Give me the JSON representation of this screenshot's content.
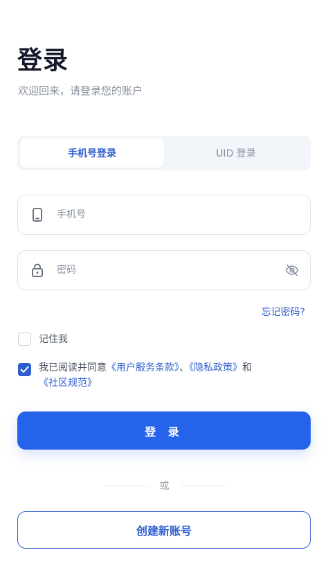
{
  "header": {
    "title": "登录",
    "subtitle": "欢迎回来，请登录您的账户"
  },
  "tabs": [
    {
      "label": "手机号登录",
      "active": true
    },
    {
      "label": "UID 登录",
      "active": false
    }
  ],
  "phone": {
    "placeholder": "手机号",
    "value": "",
    "icon": "phone-icon"
  },
  "password": {
    "placeholder": "密码",
    "value": "",
    "icon": "lock-icon",
    "toggle_icon": "eye-off-icon"
  },
  "forgot_label": "忘记密码?",
  "remember": {
    "label": "记住我",
    "checked": false
  },
  "agreement": {
    "checked": true,
    "prefix": "我已阅读并同意",
    "terms": "《用户服务条款》",
    "sep": "、",
    "privacy": "《隐私政策》",
    "and": "和",
    "community": "《社区规范》"
  },
  "login_button_label": "登 录",
  "divider_label": "或",
  "create_account_label": "创建新账号",
  "colors": {
    "primary": "#2563eb",
    "link": "#2f5fcf",
    "muted": "#8a91a0",
    "border": "#dfe3ea"
  }
}
